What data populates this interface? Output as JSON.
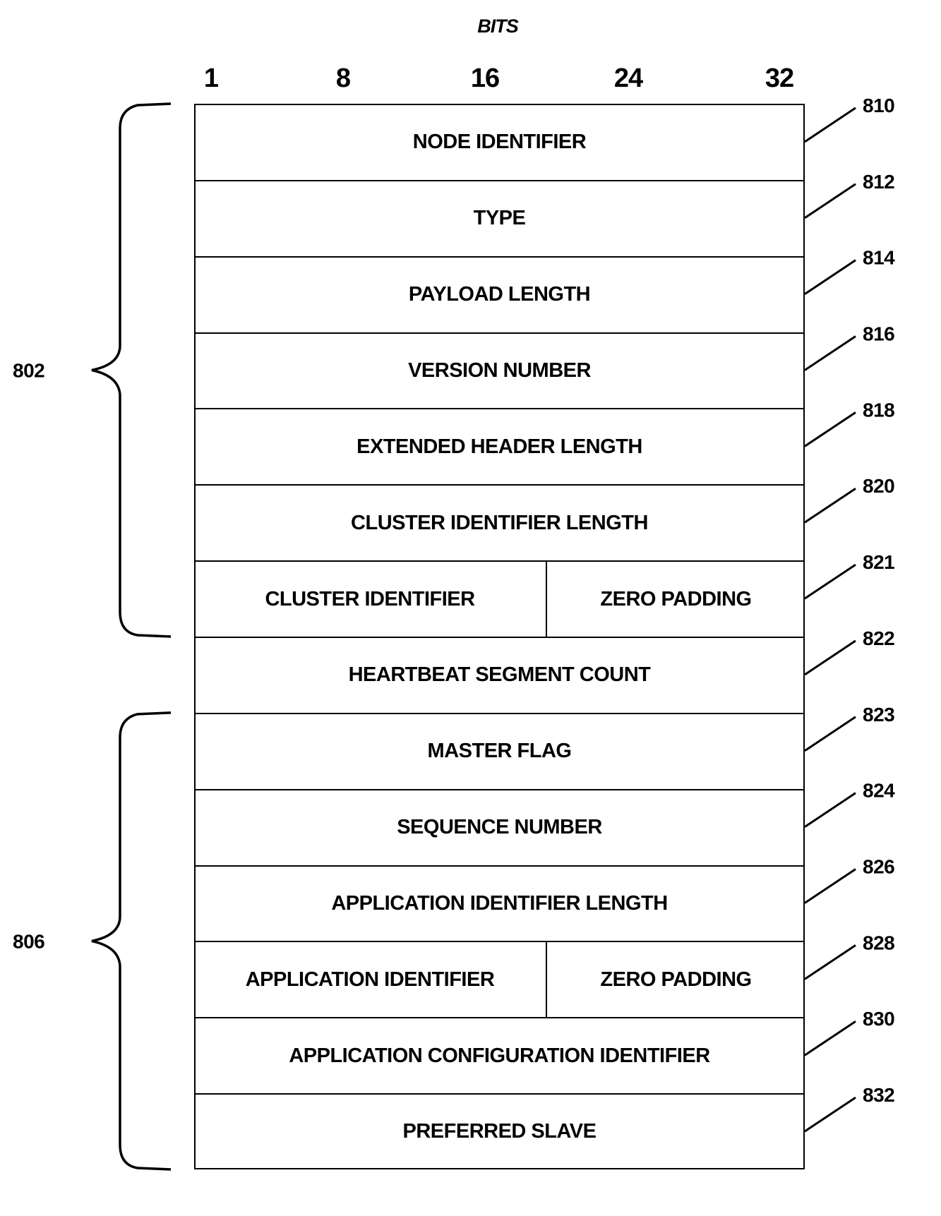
{
  "diagram": {
    "axis_title": "BITS",
    "bit_markers": [
      {
        "label": "1"
      },
      {
        "label": "8"
      },
      {
        "label": "16"
      },
      {
        "label": "24"
      },
      {
        "label": "32"
      }
    ],
    "rows": [
      {
        "ref": "810",
        "fields": [
          "NODE IDENTIFIER"
        ]
      },
      {
        "ref": "812",
        "fields": [
          "TYPE"
        ]
      },
      {
        "ref": "814",
        "fields": [
          "PAYLOAD LENGTH"
        ]
      },
      {
        "ref": "816",
        "fields": [
          "VERSION NUMBER"
        ]
      },
      {
        "ref": "818",
        "fields": [
          "EXTENDED HEADER LENGTH"
        ]
      },
      {
        "ref": "820",
        "fields": [
          "CLUSTER IDENTIFIER LENGTH"
        ]
      },
      {
        "ref": "821",
        "fields": [
          "CLUSTER IDENTIFIER",
          "ZERO PADDING"
        ]
      },
      {
        "ref": "822",
        "fields": [
          "HEARTBEAT SEGMENT COUNT"
        ]
      },
      {
        "ref": "823",
        "fields": [
          "MASTER FLAG"
        ]
      },
      {
        "ref": "824",
        "fields": [
          "SEQUENCE NUMBER"
        ]
      },
      {
        "ref": "826",
        "fields": [
          "APPLICATION IDENTIFIER LENGTH"
        ]
      },
      {
        "ref": "828",
        "fields": [
          "APPLICATION IDENTIFIER",
          "ZERO PADDING"
        ]
      },
      {
        "ref": "830",
        "fields": [
          "APPLICATION CONFIGURATION IDENTIFIER"
        ]
      },
      {
        "ref": "832",
        "fields": [
          "PREFERRED SLAVE"
        ]
      }
    ],
    "groups": [
      {
        "ref": "802",
        "first_row": 0,
        "last_row": 6
      },
      {
        "ref": "806",
        "first_row": 8,
        "last_row": 13
      }
    ]
  }
}
